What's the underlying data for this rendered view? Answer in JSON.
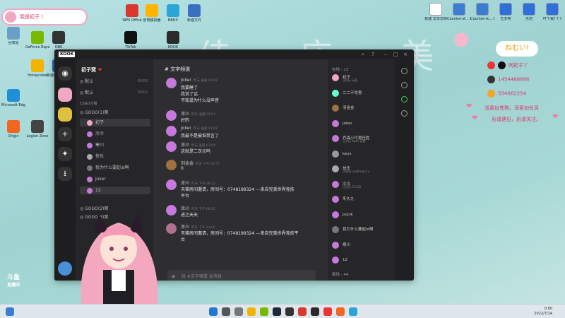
{
  "desktop": {
    "bg_text": "佳 庙 美",
    "streamer_tag": "我是初子 ！",
    "icons": [
      {
        "label": "回收站",
        "color": "#6aa0c8"
      },
      {
        "label": "Microsoft Edge",
        "color": "#1f8fd8"
      },
      {
        "label": "WPS Office",
        "color": "#d9392d"
      },
      {
        "label": "雷电模拟器",
        "color": "#ffb400"
      },
      {
        "label": "BBDX",
        "color": "#2aa5d8"
      },
      {
        "label": "新建文件",
        "color": "#3b6fc2"
      },
      {
        "label": "GeForce Experience",
        "color": "#76b900"
      },
      {
        "label": "OBS",
        "color": "#333"
      },
      {
        "label": "Honeyview",
        "color": "#f2b400"
      },
      {
        "label": "TikTok",
        "color": "#111"
      },
      {
        "label": "新建DOCX 文档",
        "color": "#2b5fb8"
      },
      {
        "label": "Origin",
        "color": "#f26522"
      },
      {
        "label": "Legion Zone",
        "color": "#444"
      },
      {
        "label": "KOOK",
        "color": "#2a2a2a"
      }
    ],
    "right_icons": [
      {
        "label": "新建 文本文档",
        "color": "#fff"
      },
      {
        "label": "Counter-st... Global Of...",
        "color": "#3a7dd1"
      },
      {
        "label": "Counter-st... Global Of...",
        "color": "#3a7dd1"
      },
      {
        "label": "五天啊",
        "color": "#2f6fd8"
      },
      {
        "label": "示范",
        "color": "#2f6fd8"
      },
      {
        "label": "叮个我? ? ?",
        "color": "#2f6fd8"
      }
    ]
  },
  "overlay": {
    "speech": "ねむい!",
    "lines": [
      {
        "text": "网初子丫",
        "color": "#d33b6f"
      },
      {
        "text": "1454488886",
        "color": "#d33b6f"
      },
      {
        "text": "554662254",
        "color": "#d33b6f"
      }
    ],
    "slogan1": "浅喜似苍狗，深爱如长风",
    "slogan2": "后请遇见，后请关注。",
    "platform": "斗鱼",
    "platform_sub": "直播间"
  },
  "kook": {
    "logo": "KOOK",
    "server_name": "初子窝",
    "channels": [
      {
        "label": "默认",
        "meta": "00/00",
        "kind": "voice"
      },
      {
        "label": "默认",
        "meta": "00/02",
        "kind": "voice"
      }
    ],
    "group1": "CSGO分组",
    "group2": "GOGO(1)窝",
    "voice_members": [
      {
        "label": "初子",
        "color": "#f2a7c3",
        "sel": true
      },
      {
        "label": "冷冷",
        "color": "#c678dd"
      },
      {
        "label": "寒川",
        "color": "#c678dd"
      },
      {
        "label": "快乐",
        "color": "#aaa"
      },
      {
        "label": "我为什么要起id啊",
        "color": "#777"
      },
      {
        "label": "Joker",
        "color": "#c678dd"
      },
      {
        "label": "12",
        "color": "#c678dd",
        "sel": true
      }
    ],
    "group3": "GOGO(2)窝",
    "group3b": "GOGO(3)窝",
    "channel_title": "文字频道",
    "messages": [
      {
        "name": "Joker",
        "time": "昨天 凌晨 01:02",
        "color": "#c678dd",
        "lines": [
          "我要睡了",
          "我说了话",
          "不知道为什么没声音"
        ]
      },
      {
        "name": "凉川",
        "time": "昨天 凌晨 01:03",
        "color": "#c678dd",
        "lines": [
          "好的"
        ]
      },
      {
        "name": "Joker",
        "time": "昨天 凌晨 01:03",
        "color": "#c678dd",
        "lines": [
          "我最不是被谁禁言了"
        ]
      },
      {
        "name": "凉川",
        "time": "昨天 凌晨 01:04",
        "color": "#c678dd",
        "lines": [
          "这就是二次元吗"
        ]
      },
      {
        "name": "刘金金",
        "time": "昨天 下午 05:57",
        "color": "#a07040",
        "lines": [
          "0"
        ]
      },
      {
        "name": "凉川",
        "time": "昨天 下午 09:12",
        "color": "#c678dd",
        "lines": [
          "天梯房间邀请，房间号：0748189324 ---来自完美世界竞技",
          "平台"
        ]
      },
      {
        "name": "凉川",
        "time": "昨天 下午 09:15",
        "color": "#c678dd",
        "lines": [
          "进之天天"
        ]
      },
      {
        "name": "凉川",
        "time": "昨天 下午 11:02",
        "color": "#b07090",
        "lines": [
          "天梯房间邀请，房间号：0748189324 ---来自完美世界竞技平",
          "台"
        ]
      }
    ],
    "input_placeholder": "给 #文字频道 发消息",
    "online_header": "在线 - 13",
    "members": [
      {
        "name": "初子",
        "sub": "正在玩 玩家",
        "color": "#f2a7c3"
      },
      {
        "name": "二二不吃害",
        "sub": "",
        "color": "#6fc"
      },
      {
        "name": "羽金金",
        "sub": "",
        "color": "#a07040"
      },
      {
        "name": "Joker",
        "sub": "",
        "color": "#c678dd"
      },
      {
        "name": "乔森小可爱任胜",
        "sub": "正在玩 Apex 英雄",
        "color": "#c678dd"
      },
      {
        "name": "keys",
        "sub": "",
        "color": "#999"
      },
      {
        "name": "快乐",
        "sub": "正在听 anything 4 u",
        "color": "#aaa"
      },
      {
        "name": "冷冷",
        "sub": "正在玩 CS:GO",
        "color": "#c678dd"
      },
      {
        "name": "冬久九",
        "sub": "",
        "color": "#c678dd"
      },
      {
        "name": "pocik",
        "sub": "",
        "color": "#c678dd"
      },
      {
        "name": "我为什么要起id啊",
        "sub": "",
        "color": "#777"
      },
      {
        "name": "寒川",
        "sub": "",
        "color": "#c678dd"
      },
      {
        "name": "12",
        "sub": "",
        "color": "#c678dd"
      }
    ],
    "offline_header": "离线 - 44"
  },
  "taskbar": {
    "time": "0:00",
    "date": "2022/7/14"
  }
}
